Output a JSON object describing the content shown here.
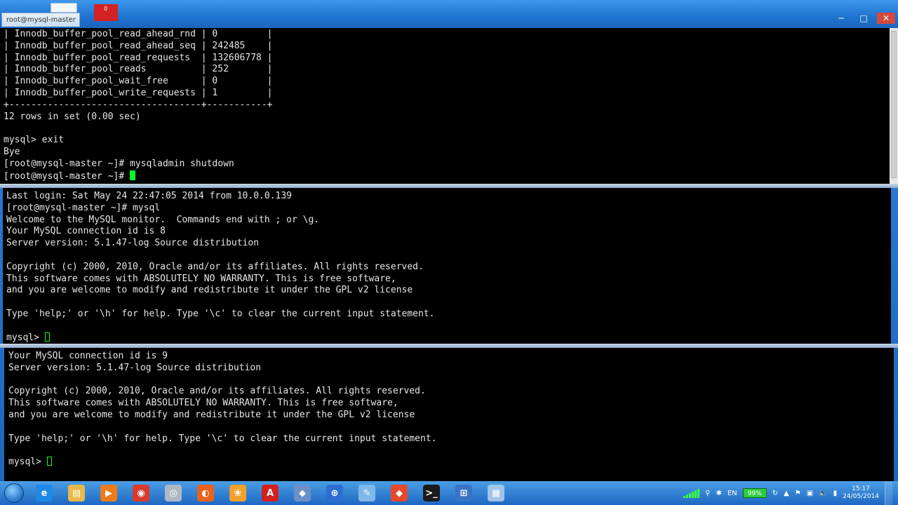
{
  "window": {
    "tab_title": "root@mysql-master",
    "tab_close": "×",
    "thumb_badge": "0",
    "controls": {
      "minimize": "─",
      "maximize": "□",
      "close": "✕"
    }
  },
  "terminals": {
    "top": {
      "lines": [
        "| Innodb_buffer_pool_read_ahead_rnd | 0         |",
        "| Innodb_buffer_pool_read_ahead_seq | 242485    |",
        "| Innodb_buffer_pool_read_requests  | 132606778 |",
        "| Innodb_buffer_pool_reads          | 252       |",
        "| Innodb_buffer_pool_wait_free      | 0         |",
        "| Innodb_buffer_pool_write_requests | 1         |",
        "+-----------------------------------+-----------+",
        "12 rows in set (0.00 sec)",
        "",
        "mysql> exit",
        "Bye",
        "[root@mysql-master ~]# mysqladmin shutdown"
      ],
      "prompt": "[root@mysql-master ~]# "
    },
    "middle": {
      "lines": [
        "Last login: Sat May 24 22:47:05 2014 from 10.0.0.139",
        "[root@mysql-master ~]# mysql",
        "Welcome to the MySQL monitor.  Commands end with ; or \\g.",
        "Your MySQL connection id is 8",
        "Server version: 5.1.47-log Source distribution",
        "",
        "Copyright (c) 2000, 2010, Oracle and/or its affiliates. All rights reserved.",
        "This software comes with ABSOLUTELY NO WARRANTY. This is free software,",
        "and you are welcome to modify and redistribute it under the GPL v2 license",
        "",
        "Type 'help;' or '\\h' for help. Type '\\c' to clear the current input statement.",
        ""
      ],
      "prompt": "mysql> "
    },
    "bottom": {
      "lines": [
        "Your MySQL connection id is 9",
        "Server version: 5.1.47-log Source distribution",
        "",
        "Copyright (c) 2000, 2010, Oracle and/or its affiliates. All rights reserved.",
        "This software comes with ABSOLUTELY NO WARRANTY. This is free software,",
        "and you are welcome to modify and redistribute it under the GPL v2 license",
        "",
        "Type 'help;' or '\\h' for help. Type '\\c' to clear the current input statement.",
        ""
      ],
      "prompt": "mysql> "
    },
    "colors": {
      "background": "#000000",
      "foreground": "#e6e6e6",
      "cursor": "#00ff2a"
    }
  },
  "taskbar": {
    "apps": [
      {
        "name": "ie-icon",
        "glyph": "e",
        "color": "#1e88e5"
      },
      {
        "name": "explorer-icon",
        "glyph": "▤",
        "color": "#e8b84a"
      },
      {
        "name": "media-player-icon",
        "glyph": "▶",
        "color": "#f07a1a"
      },
      {
        "name": "chrome-icon",
        "glyph": "◉",
        "color": "#d93a2b"
      },
      {
        "name": "fingerprint-icon",
        "glyph": "◎",
        "color": "#b0b8c4"
      },
      {
        "name": "firefox-icon",
        "glyph": "◐",
        "color": "#e8621a"
      },
      {
        "name": "app-orange-icon",
        "glyph": "❀",
        "color": "#f2a12b"
      },
      {
        "name": "acrobat-icon",
        "glyph": "A",
        "color": "#d42020"
      },
      {
        "name": "virtualbox-icon",
        "glyph": "◆",
        "color": "#6b8fc7"
      },
      {
        "name": "network-icon",
        "glyph": "⊕",
        "color": "#2d6fd1"
      },
      {
        "name": "notepad-icon",
        "glyph": "✎",
        "color": "#7fb8e8"
      },
      {
        "name": "git-icon",
        "glyph": "◆",
        "color": "#e8492b"
      },
      {
        "name": "terminal-icon",
        "glyph": ">_",
        "color": "#1b1b1b"
      },
      {
        "name": "remote-desktop-icon",
        "glyph": "⊞",
        "color": "#3a73c4"
      },
      {
        "name": "file-icon",
        "glyph": "▦",
        "color": "#9fc3ea"
      }
    ],
    "tray": {
      "language": "EN",
      "battery": "99%",
      "time": "15:17",
      "date": "24/05/2014"
    }
  }
}
